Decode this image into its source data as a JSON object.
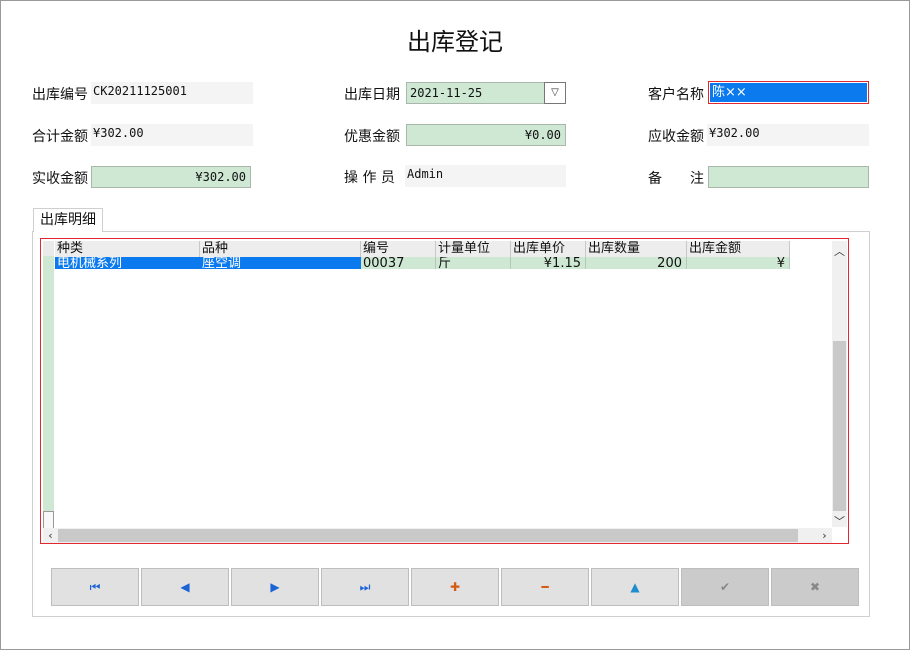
{
  "form": {
    "title": "出库登记",
    "fields": {
      "out_no_label": "出库编号",
      "out_no": "CK20211125001",
      "out_date_label": "出库日期",
      "out_date": "2021-11-25",
      "customer_label": "客户名称",
      "customer": "陈××",
      "total_label": "合计金额",
      "total": "¥302.00",
      "discount_label": "优惠金额",
      "discount": "¥0.00",
      "receivable_label": "应收金额",
      "receivable": "¥302.00",
      "received_label": "实收金额",
      "received": "¥302.00",
      "operator_label": "操 作 员",
      "operator": "Admin",
      "remark_label": "备　　注",
      "remark": ""
    }
  },
  "tab": {
    "label": "出库明细"
  },
  "grid": {
    "columns": [
      "种类",
      "品种",
      "编号",
      "计量单位",
      "出库单价",
      "出库数量",
      "出库金额"
    ],
    "rows": [
      [
        "电机械系列",
        "座空调",
        "00037",
        "斤",
        "¥1.15",
        "200",
        "¥"
      ]
    ]
  },
  "navigator": {
    "buttons": [
      {
        "name": "first-record-button",
        "icon": "first-icon",
        "glyph": "⏮",
        "color": "#1a64d6",
        "enabled": true
      },
      {
        "name": "prior-record-button",
        "icon": "prior-icon",
        "glyph": "◀",
        "color": "#1a64d6",
        "enabled": true
      },
      {
        "name": "next-record-button",
        "icon": "next-icon",
        "glyph": "▶",
        "color": "#1a64d6",
        "enabled": true
      },
      {
        "name": "last-record-button",
        "icon": "last-icon",
        "glyph": "⏭",
        "color": "#1a64d6",
        "enabled": true
      },
      {
        "name": "insert-record-button",
        "icon": "plus-icon",
        "glyph": "✚",
        "color": "#d55a12",
        "enabled": true
      },
      {
        "name": "delete-record-button",
        "icon": "minus-icon",
        "glyph": "━",
        "color": "#d55a12",
        "enabled": true
      },
      {
        "name": "edit-record-button",
        "icon": "edit-icon",
        "glyph": "▲",
        "color": "#1f8ecf",
        "enabled": true
      },
      {
        "name": "post-record-button",
        "icon": "check-icon",
        "glyph": "✔",
        "color": "#888888",
        "enabled": false
      },
      {
        "name": "cancel-record-button",
        "icon": "cancel-icon",
        "glyph": "✖",
        "color": "#888888",
        "enabled": false
      }
    ]
  },
  "colors": {
    "selection": "#0a7aee",
    "green_field": "#cfe8d4",
    "focus_border": "#e0282e"
  }
}
